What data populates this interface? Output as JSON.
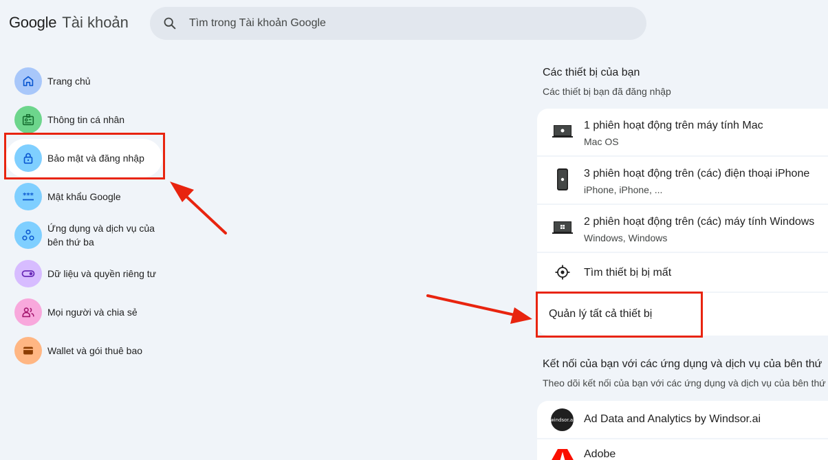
{
  "header": {
    "logo_google": "Google",
    "logo_account": "Tài khoản",
    "search_placeholder": "Tìm trong Tài khoản Google"
  },
  "nav": {
    "items": [
      {
        "label": "Trang chủ",
        "icon": "home-icon",
        "color": "#a8c7fa"
      },
      {
        "label": "Thông tin cá nhân",
        "icon": "id-card-icon",
        "color": "#6dd58c"
      },
      {
        "label": "Bảo mật và đăng nhập",
        "icon": "lock-icon",
        "color": "#7fcfff"
      },
      {
        "label": "Mật khẩu Google",
        "icon": "password-icon",
        "color": "#7fcfff"
      },
      {
        "label": "Ứng dụng và dịch vụ của bên thứ ba",
        "icon": "apps-icon",
        "color": "#7fcfff"
      },
      {
        "label": "Dữ liệu và quyền riêng tư",
        "icon": "toggle-icon",
        "color": "#d7bcff"
      },
      {
        "label": "Mọi người và chia sẻ",
        "icon": "people-icon",
        "color": "#f8a8dc"
      },
      {
        "label": "Wallet và gói thuê bao",
        "icon": "wallet-icon",
        "color": "#ffb683"
      }
    ],
    "active_index": 2
  },
  "devices": {
    "title": "Các thiết bị của bạn",
    "subtitle": "Các thiết bị bạn đã đăng nhập",
    "rows": [
      {
        "title": "1 phiên hoạt động trên máy tính Mac",
        "sub": "Mac OS",
        "icon": "laptop-mac-icon"
      },
      {
        "title": "3 phiên hoạt động trên (các) điện thoại iPhone",
        "sub": "iPhone, iPhone, ...",
        "icon": "iphone-icon"
      },
      {
        "title": "2 phiên hoạt động trên (các) máy tính Windows",
        "sub": "Windows, Windows",
        "icon": "laptop-windows-icon"
      }
    ],
    "find_lost": "Tìm thiết bị bị mất",
    "manage_all": "Quản lý tất cả thiết bị"
  },
  "connections": {
    "title": "Kết nối của bạn với các ứng dụng và dịch vụ của bên thứ",
    "subtitle": "Theo dõi kết nối của bạn với các ứng dụng và dịch vụ của bên thứ",
    "rows": [
      {
        "title": "Ad Data and Analytics by Windsor.ai",
        "logo_text": "windsor.ai"
      },
      {
        "title": "Adobe"
      }
    ]
  },
  "colors": {
    "annotation_red": "#e8240f",
    "page_bg": "#f0f4f9"
  }
}
